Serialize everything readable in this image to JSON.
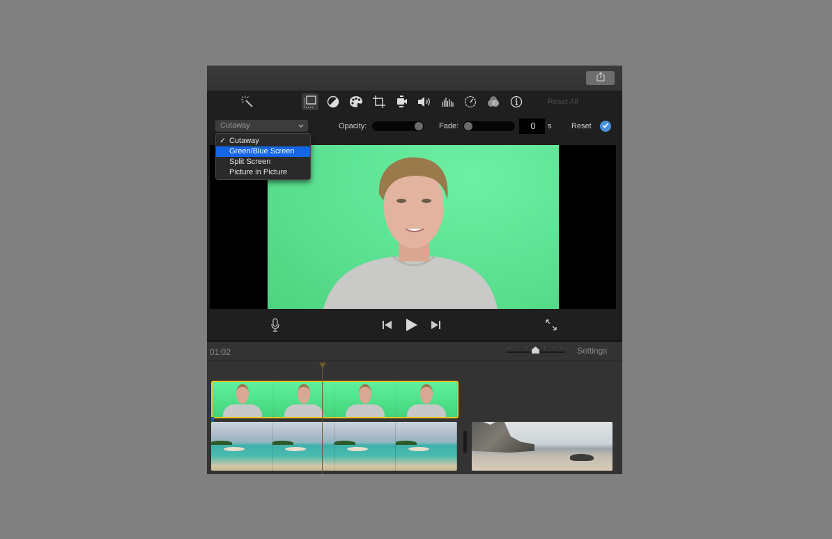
{
  "window": {
    "share_icon": "share-icon"
  },
  "toolbar": {
    "icons": [
      {
        "name": "magic-wand-icon",
        "label": "Enhance"
      },
      {
        "name": "video-overlay-icon",
        "label": "Video overlay settings",
        "active": true
      },
      {
        "name": "color-balance-icon",
        "label": "Color balance"
      },
      {
        "name": "color-correction-icon",
        "label": "Color correction"
      },
      {
        "name": "crop-icon",
        "label": "Cropping"
      },
      {
        "name": "stabilization-icon",
        "label": "Stabilization"
      },
      {
        "name": "volume-icon",
        "label": "Volume"
      },
      {
        "name": "noise-reduction-icon",
        "label": "Noise reduction and equalizer"
      },
      {
        "name": "speed-icon",
        "label": "Speed"
      },
      {
        "name": "clip-filter-icon",
        "label": "Clip filter"
      },
      {
        "name": "info-icon",
        "label": "Clip information"
      }
    ],
    "reset_all_label": "Reset All"
  },
  "overlay_controls": {
    "mode_select": {
      "value": "Cutaway",
      "options": [
        "Cutaway",
        "Green/Blue Screen",
        "Split Screen",
        "Picture in Picture"
      ],
      "checked": "Cutaway",
      "highlighted": "Green/Blue Screen"
    },
    "opacity_label": "Opacity:",
    "opacity_value_percent": 100,
    "fade_label": "Fade:",
    "fade_value_percent": 0,
    "fade_seconds": "0",
    "fade_unit": "s",
    "reset_label": "Reset",
    "apply_icon": "checkmark-icon"
  },
  "viewer": {
    "content": "Man in grey sweatshirt in front of green screen"
  },
  "transport": {
    "voiceover_icon": "microphone-icon",
    "previous_icon": "skip-back-icon",
    "play_icon": "play-icon",
    "next_icon": "skip-forward-icon",
    "fullscreen_icon": "fullscreen-icon"
  },
  "timeline": {
    "timecode": "01:02",
    "settings_label": "Settings",
    "zoom_level_fraction": 0.48,
    "colors": {
      "selected_clip_border": "#f0c419",
      "playhead": "#6b5d2f",
      "green_screen": "#5ee598"
    },
    "overlay_clip": {
      "frames": 4,
      "selected": true,
      "content": "green screen presenter"
    },
    "main_clips": [
      {
        "frames": 4,
        "content": "tropical beach"
      },
      {
        "frames": 1,
        "content": "rocky beach"
      }
    ]
  }
}
